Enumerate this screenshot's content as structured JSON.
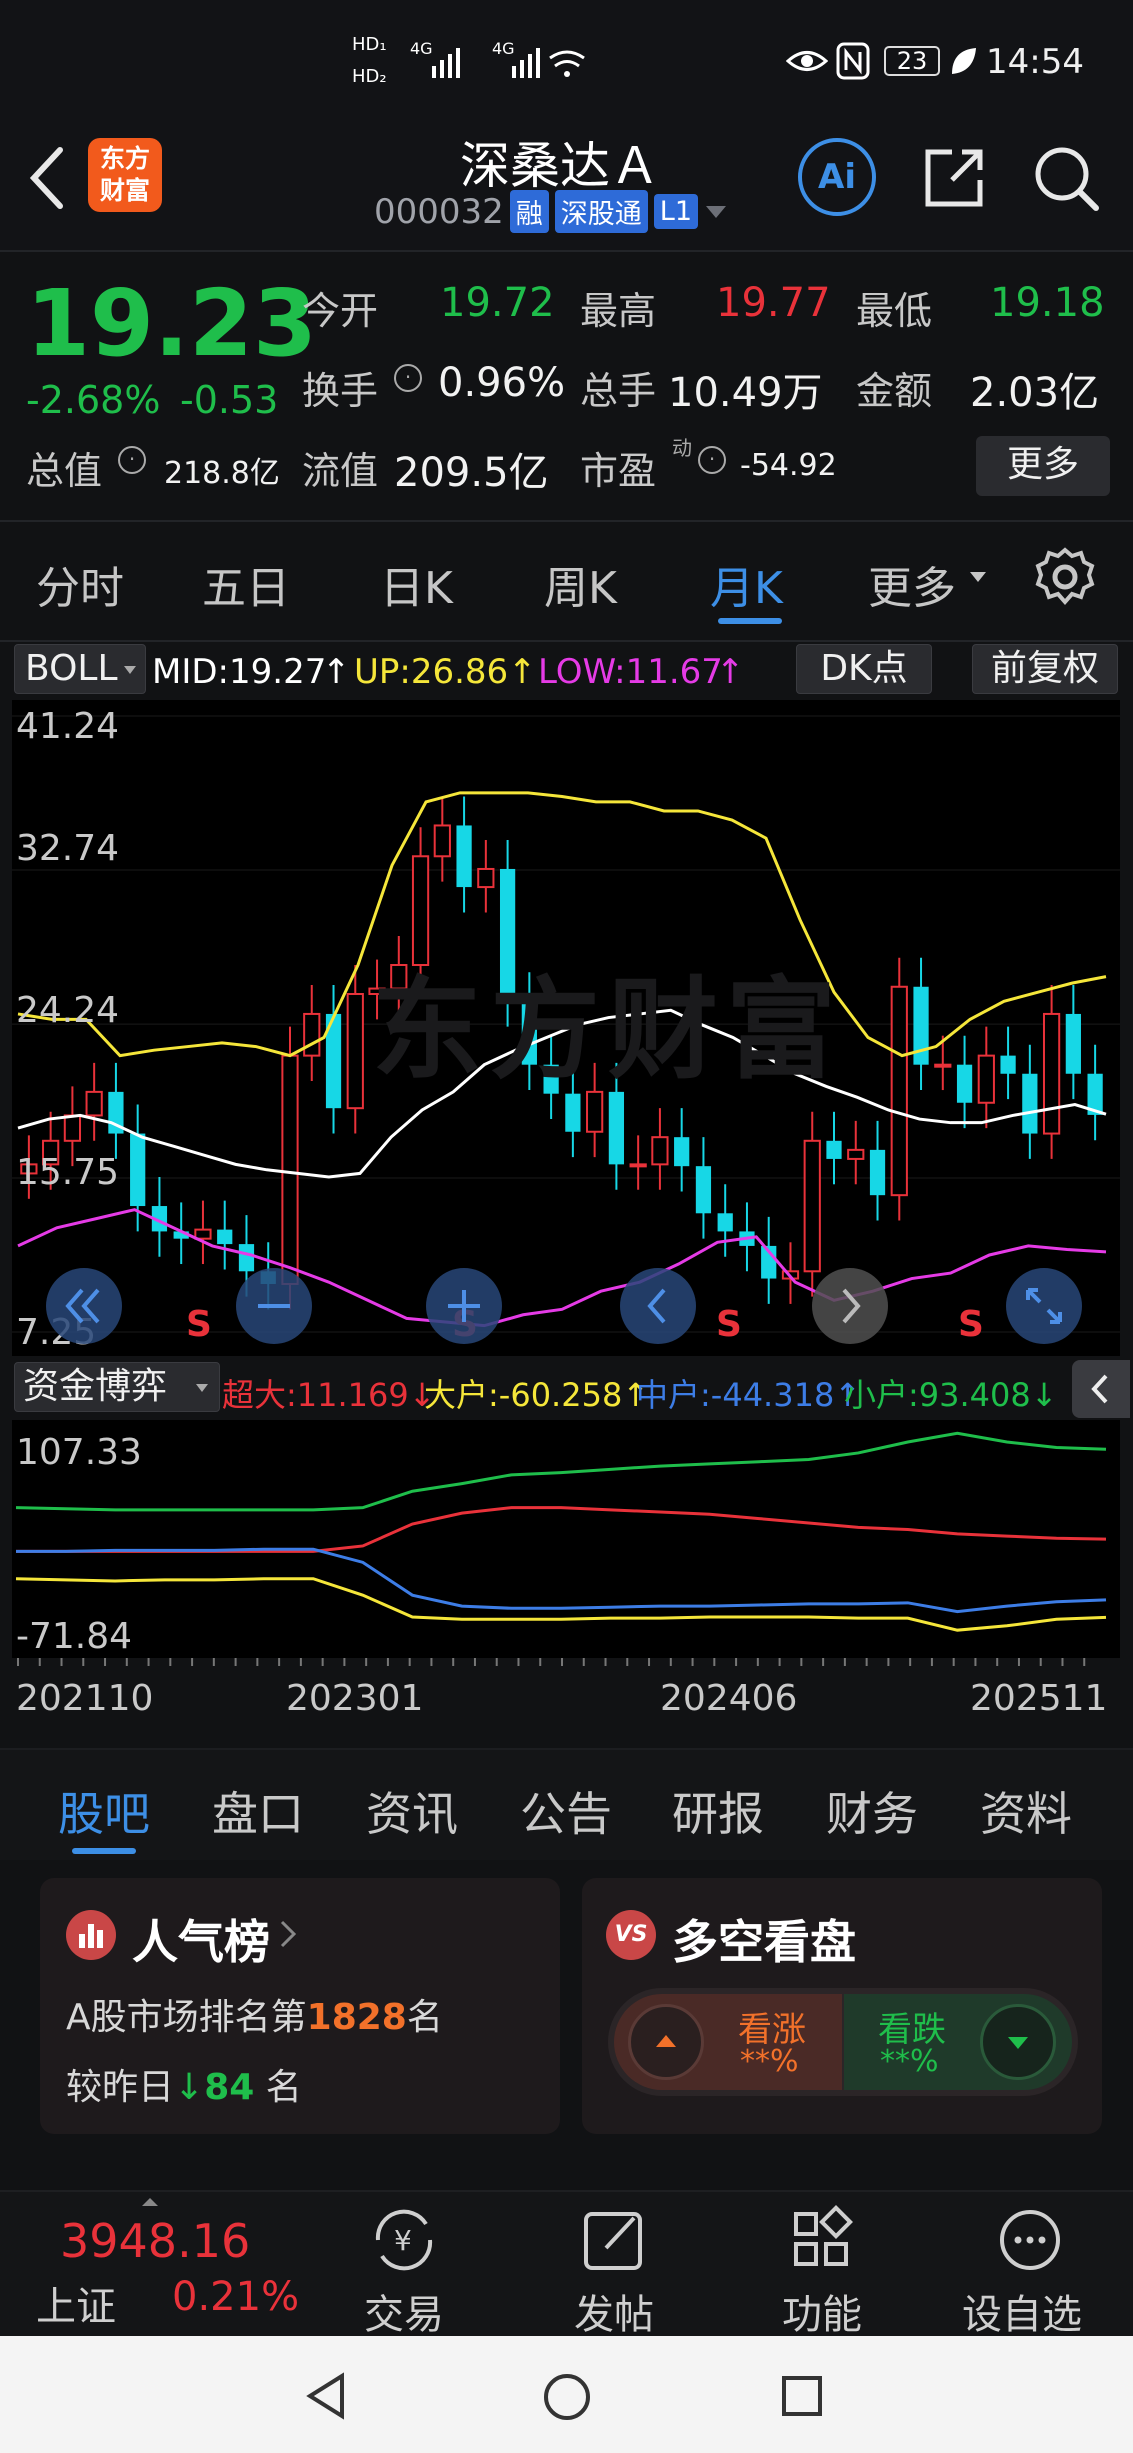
{
  "status_bar": {
    "hd1": "HD₁",
    "hd2": "HD₂",
    "net1": "4G",
    "net2": "4G",
    "wifi": "6",
    "battery": "23",
    "time": "14:54"
  },
  "header": {
    "back_icon": "back-arrow-icon",
    "logo_text": "东方\n财富",
    "logo_line1": "东方",
    "logo_line2": "财富",
    "title": "深桑达Ａ",
    "code": "000032",
    "tag_rong": "融",
    "tag_sgt": "深股通",
    "tag_l1": "L1",
    "ai_label": "Ai"
  },
  "quote": {
    "price": "19.23",
    "change_pct": "-2.68%",
    "change": "-0.53",
    "open_label": "今开",
    "open": "19.72",
    "high_label": "最高",
    "high": "19.77",
    "low_label": "最低",
    "low": "19.18",
    "turnover_label": "换手",
    "turnover": "0.96%",
    "volume_label": "总手",
    "volume": "10.49万",
    "amount_label": "金额",
    "amount": "2.03亿",
    "mktcap_label": "总值",
    "mktcap": "218.8亿",
    "float_label": "流值",
    "float": "209.5亿",
    "pe_label": "市盈",
    "pe_sup": "动",
    "pe": "-54.92",
    "more_btn": "更多"
  },
  "period_tabs": [
    "分时",
    "五日",
    "日K",
    "周K",
    "月K",
    "更多"
  ],
  "period_active": "月K",
  "indicator": {
    "name": "BOLL",
    "mid": "MID:19.27",
    "up": "UP:26.86",
    "low": "LOW:11.67",
    "arrow": "↑",
    "dk_btn": "DK点",
    "fq_btn": "前复权",
    "mid_color": "#ffffff",
    "up_color": "#f5e63a",
    "low_color": "#e53be6"
  },
  "price_axis": [
    "41.24",
    "32.74",
    "24.24",
    "15.75",
    "7.25"
  ],
  "sell_marker": "S",
  "watermark": "东方财富",
  "fund": {
    "name": "资金博弈",
    "super": "超大:11.169↓",
    "large": "大户:-60.258↑",
    "mid": "中户:-44.318↑",
    "small": "小户:93.408↓",
    "axis_top": "107.33",
    "axis_bottom": "-71.84",
    "super_color": "#e9323a",
    "large_color": "#f5e63a",
    "mid_color": "#3d7de6",
    "small_color": "#1fbe4b"
  },
  "date_axis": [
    "202110",
    "202301",
    "202406",
    "202511"
  ],
  "bottom_tabs": [
    "股吧",
    "盘口",
    "资讯",
    "公告",
    "研报",
    "财务",
    "资料"
  ],
  "bottom_active": "股吧",
  "popularity": {
    "title": "人气榜",
    "rank_prefix": "A股市场排名第",
    "rank": "1828",
    "rank_suffix": "名",
    "change_prefix": "较昨日",
    "change": "84",
    "change_suffix": "名"
  },
  "sentiment": {
    "title": "多空看盘",
    "bull_label": "看涨",
    "bull_value": "**%",
    "bear_label": "看跌",
    "bear_value": "**%"
  },
  "bottom_nav": {
    "index_value": "3948.16",
    "index_name": "上证",
    "index_change": "0.21%",
    "trade": "交易",
    "post": "发帖",
    "func": "功能",
    "watch": "设自选"
  },
  "chart_data": {
    "type": "candlestick",
    "period": "monthly",
    "y_range": [
      7.25,
      41.24
    ],
    "y_ticks": [
      "41.24",
      "32.74",
      "24.24",
      "15.75",
      "7.25"
    ],
    "x_ticks": [
      "202110",
      "202301",
      "202406",
      "202511"
    ],
    "indicator": "BOLL",
    "series": [
      {
        "name": "MID",
        "last": 19.27
      },
      {
        "name": "UP",
        "last": 26.86
      },
      {
        "name": "LOW",
        "last": 11.67
      }
    ],
    "fund_flow": {
      "y_range": [
        -71.84,
        107.33
      ],
      "series": [
        {
          "name": "超大",
          "last": 11.169
        },
        {
          "name": "大户",
          "last": -60.258
        },
        {
          "name": "中户",
          "last": -44.318
        },
        {
          "name": "小户",
          "last": 93.408
        }
      ]
    }
  }
}
